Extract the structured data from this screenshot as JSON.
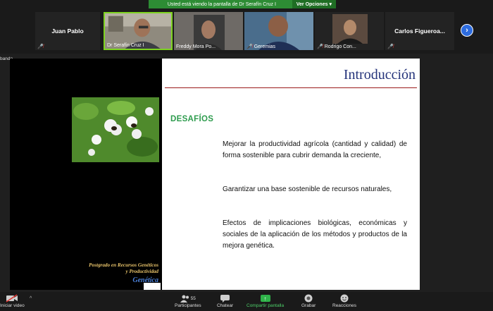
{
  "banner": {
    "message": "Usted está viendo la pantalla de Dr Serafín Cruz I",
    "options_label": "Ver Opciones",
    "options_caret": "▾"
  },
  "participants": [
    {
      "name": "Juan Pablo",
      "video": false
    },
    {
      "name": "Dr Serafín Cruz I",
      "video": true,
      "active": true
    },
    {
      "name": "Freddy Mora Po...",
      "video": true
    },
    {
      "name": "Geremias",
      "video": true
    },
    {
      "name": "Rodrigo Con...",
      "video": true
    },
    {
      "name": "Carlos  Figueroa...",
      "video": false
    }
  ],
  "next_glyph": "›",
  "screen": {
    "sharer_label": "bando"
  },
  "slide": {
    "title": "Introducción",
    "heading": "DESAFÍOS",
    "paragraphs": [
      "Mejorar la productividad agrícola (cantidad y calidad) de forma sostenible para cubrir demanda la creciente,",
      "Garantizar una base sostenible de recursos naturales,",
      "Efectos de implicaciones biológicas, económicas y sociales de la aplicación de los métodos y productos de la mejora genética."
    ],
    "program_line1": "Postgrado en Recursos Genéticos",
    "program_line2": "y Productividad",
    "program_line3": "Genética"
  },
  "toolbar": {
    "start_video": "Iniciar video",
    "participants": "Participantes",
    "participants_count": "55",
    "chat": "Chatear",
    "share": "Compartir pantalla",
    "record": "Grabar",
    "reactions": "Reacciones",
    "caret": "^"
  },
  "colors": {
    "banner_green": "#2d8c34",
    "active_speaker": "#7ed321",
    "share_green": "#2fb34a",
    "title_blue": "#24337a",
    "heading_green": "#2e9c4e"
  }
}
